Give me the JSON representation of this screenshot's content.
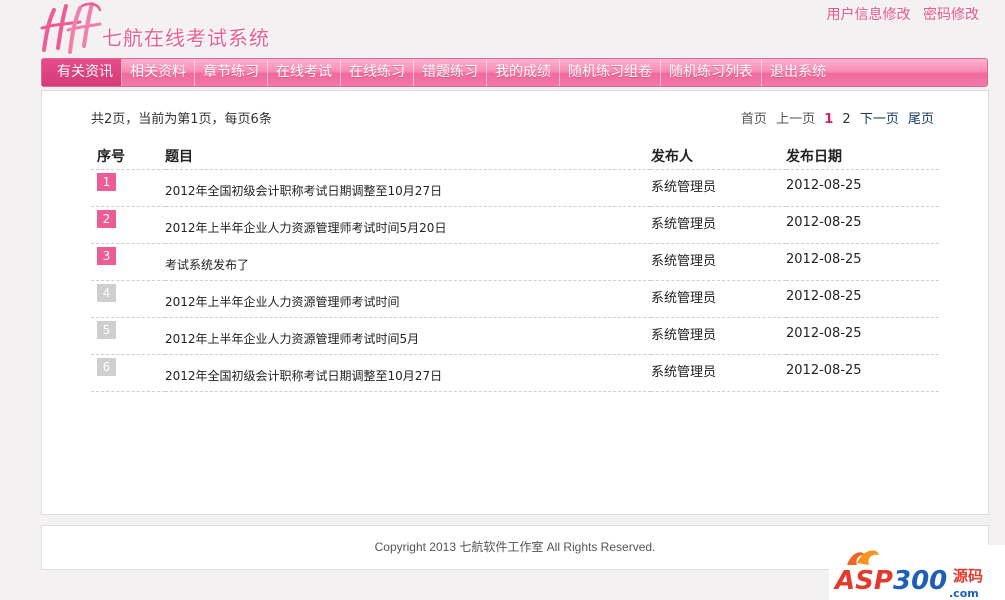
{
  "header": {
    "title": "七航在线考试系统",
    "links": [
      "用户信息修改",
      "密码修改"
    ]
  },
  "nav": {
    "items": [
      "有关资讯",
      "相关资料",
      "章节练习",
      "在线考试",
      "在线练习",
      "错题练习",
      "我的成绩",
      "随机练习组卷",
      "随机练习列表",
      "退出系统"
    ],
    "active_index": 0
  },
  "page_info": "共2页，当前为第1页，每页6条",
  "pager": {
    "first": "首页",
    "prev": "上一页",
    "pages": [
      "1",
      "2"
    ],
    "current": "1",
    "next": "下一页",
    "last": "尾页"
  },
  "table": {
    "headers": [
      "序号",
      "题目",
      "发布人",
      "发布日期"
    ],
    "rows": [
      {
        "idx": "1",
        "title": "2012年全国初级会计职称考试日期调整至10月27日",
        "author": "系统管理员",
        "date": "2012-08-25",
        "highlight": true
      },
      {
        "idx": "2",
        "title": "2012年上半年企业人力资源管理师考试时间5月20日",
        "author": "系统管理员",
        "date": "2012-08-25",
        "highlight": true
      },
      {
        "idx": "3",
        "title": "考试系统发布了",
        "author": "系统管理员",
        "date": "2012-08-25",
        "highlight": true
      },
      {
        "idx": "4",
        "title": "2012年上半年企业人力资源管理师考试时间",
        "author": "系统管理员",
        "date": "2012-08-25",
        "highlight": false
      },
      {
        "idx": "5",
        "title": "2012年上半年企业人力资源管理师考试时间5月",
        "author": "系统管理员",
        "date": "2012-08-25",
        "highlight": false
      },
      {
        "idx": "6",
        "title": "2012年全国初级会计职称考试日期调整至10月27日",
        "author": "系统管理员",
        "date": "2012-08-25",
        "highlight": false
      }
    ]
  },
  "footer": {
    "copyright": "Copyright 2013 七航软件工作室  All Rights Reserved."
  },
  "watermark": {
    "brand": "ASP300",
    "suffix": "源码",
    "domain": ".com"
  },
  "colors": {
    "accent": "#ee5c95",
    "nav_active": "#d63a78",
    "index_inactive": "#cfcfcf"
  }
}
